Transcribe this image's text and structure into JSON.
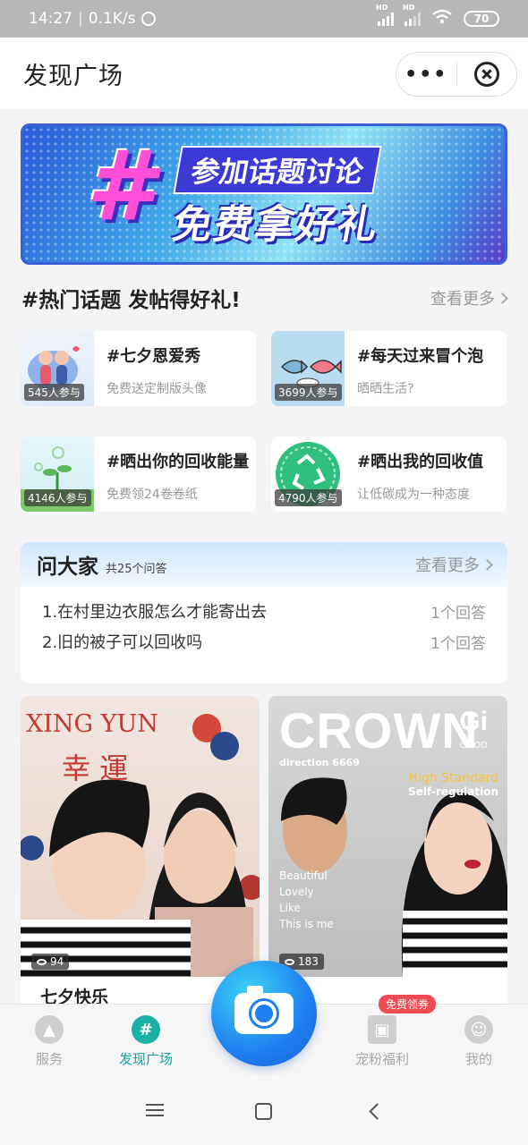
{
  "status_bar": {
    "time": "14:27",
    "network_speed": "0.1K/s",
    "battery": "70",
    "signal_label": "HD"
  },
  "header": {
    "title": "发现广场",
    "more_label": "•••"
  },
  "banner": {
    "hash": "#",
    "line1": "参加话题讨论",
    "line2": "免费拿好礼"
  },
  "hot_topics": {
    "title": "#热门话题 发帖得好礼!",
    "see_more": "查看更多",
    "items": [
      {
        "title": "#七夕恩爱秀",
        "subtitle": "免费送定制版头像",
        "participants": "545人参与"
      },
      {
        "title": "#每天过来冒个泡",
        "subtitle": "晒晒生活?",
        "participants": "3699人参与"
      },
      {
        "title": "#晒出你的回收能量",
        "subtitle": "免费领24卷卷纸",
        "participants": "4146人参与"
      },
      {
        "title": "#晒出我的回收值",
        "subtitle": "让低碳成为一种态度",
        "participants": "4790人参与"
      }
    ]
  },
  "qa": {
    "title": "问大家",
    "count": "共25个问答",
    "see_more": "查看更多",
    "items": [
      {
        "question": "1.在村里边衣服怎么才能寄出去",
        "answers": "1个回答"
      },
      {
        "question": "2.旧的被子可以回收吗",
        "answers": "1个回答"
      }
    ]
  },
  "feed": [
    {
      "title": "七夕快乐",
      "views": "94",
      "overlay_en": "XING YUN",
      "overlay_cn": "幸 運"
    },
    {
      "title": "",
      "views": "183",
      "overlay_big": "CROWN",
      "overlay_gi": "Gi",
      "overlay_good": "GOOD",
      "overlay_dir": "direction  6669",
      "overlay_hs": "High Standard",
      "overlay_sr": "Self-regulation",
      "overlay_lines": "Beautiful\nLovely\nLike\nThis is me"
    }
  ],
  "tabbar": {
    "items": [
      {
        "label": "服务",
        "icon": "service-icon"
      },
      {
        "label": "发现广场",
        "icon": "discover-icon"
      },
      {
        "label": "宠粉福利",
        "icon": "gift-icon"
      },
      {
        "label": "我的",
        "icon": "profile-icon"
      }
    ],
    "promo": "免费领券",
    "active_index": 1
  },
  "colors": {
    "accent": "#1bb0a6",
    "camera": "#1f7ff0",
    "promo": "#ef4b55"
  }
}
